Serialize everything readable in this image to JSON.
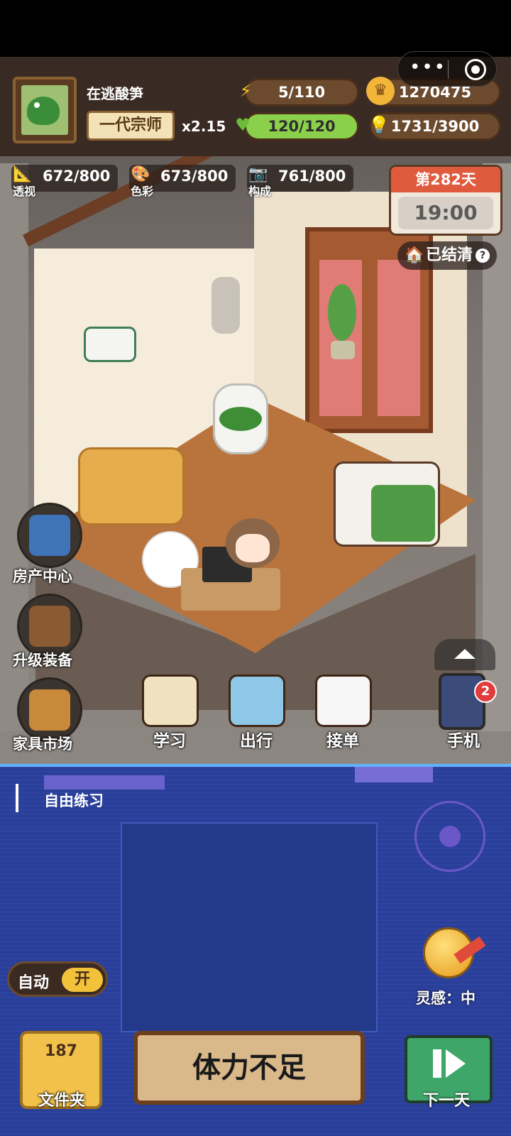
{
  "player": {
    "name": "在逃酸笋",
    "rank": "一代宗师",
    "multiplier": "x2.15"
  },
  "resources": {
    "energy": "5/110",
    "coins": "1270475",
    "health": "120/120",
    "inspiration_points": "1731/3900"
  },
  "attributes": [
    {
      "label": "透视",
      "value": "672/800",
      "icon": "ruler-icon"
    },
    {
      "label": "色彩",
      "value": "673/800",
      "icon": "palette-icon"
    },
    {
      "label": "构成",
      "value": "761/800",
      "icon": "camera-icon"
    }
  ],
  "calendar": {
    "day": "第282天",
    "time": "19:00",
    "settled": "已结清"
  },
  "side_menu": [
    {
      "label": "房产中心"
    },
    {
      "label": "升级装备"
    },
    {
      "label": "家具市场"
    }
  ],
  "actions": [
    {
      "label": "学习"
    },
    {
      "label": "出行"
    },
    {
      "label": "接单"
    },
    {
      "label": "手机",
      "badge": "2"
    }
  ],
  "panel": {
    "title": "自由练习",
    "auto_label": "自动",
    "auto_state": "开",
    "inspiration": "灵感：中",
    "folder_count": "187",
    "folder_label": "文件夹",
    "main_button": "体力不足",
    "next_day": "下一天"
  },
  "colors": {
    "panel": "#2a3f9a",
    "accent_green": "#8bd04a",
    "calendar_red": "#e05a3e",
    "button_tan": "#d9b889"
  }
}
